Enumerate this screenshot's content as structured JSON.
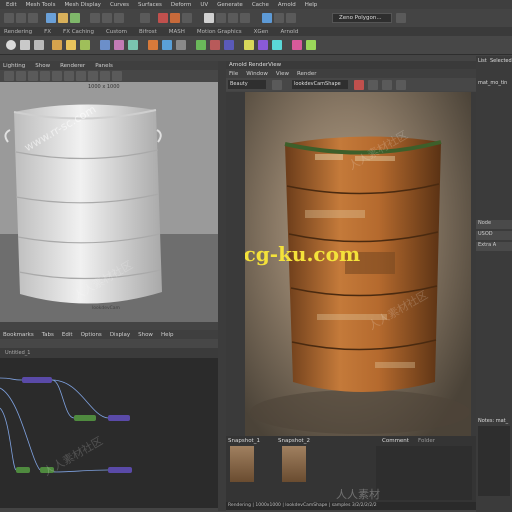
{
  "menubar": {
    "items": [
      "Edit",
      "Mesh Tools",
      "Mesh Display",
      "Curves",
      "Surfaces",
      "Deform",
      "UV",
      "Generate",
      "Cache",
      "Arnold",
      "Help"
    ]
  },
  "workspace": {
    "selected": "Zeno Polygon..."
  },
  "shelf_tabs": [
    "Rendering",
    "FX",
    "FX Caching",
    "Custom",
    "Bifrost",
    "MASH",
    "Motion Graphics",
    "XGen",
    "Arnold"
  ],
  "viewport": {
    "menu": [
      "Lighting",
      "Show",
      "Renderer",
      "Panels"
    ],
    "resolution": "1000 x 1000",
    "camera_label": "lookdevCam"
  },
  "node_editor": {
    "menu": [
      "Bookmarks",
      "Tabs",
      "Edit",
      "Options",
      "Display",
      "Show",
      "Help"
    ],
    "tabs": [
      "Untitled_1"
    ]
  },
  "render_view": {
    "title": "Arnold RenderView",
    "menu": [
      "File",
      "Window",
      "View",
      "Render"
    ],
    "mode": "Beauty",
    "camera": "lookdevCamShape",
    "snapshots": [
      "Snapshot_1",
      "Snapshot_2"
    ],
    "comment_label": "Comment",
    "folder_label": "Folder",
    "status": "Rendering | 1000x1000 | lookdevCamShape | samples 3/2/2/2/2/2"
  },
  "attribute_panel": {
    "tabs": [
      "List",
      "Selected"
    ],
    "node_name": "mat_mo_tin",
    "sections": [
      "Node",
      "USOD",
      "Extra A"
    ],
    "notes_label": "Notes: mat_"
  },
  "watermarks": {
    "center": "www.cg-ku.com",
    "cg": "www.rr-sc.com",
    "cn_mark": "人人素材社区",
    "cn_short": "人人素材"
  },
  "colors": {
    "accent": "#3a79c7",
    "node_purple": "#5a4aa8",
    "node_green": "#4f8a3f",
    "watermark_yellow": "#f4e23a"
  }
}
